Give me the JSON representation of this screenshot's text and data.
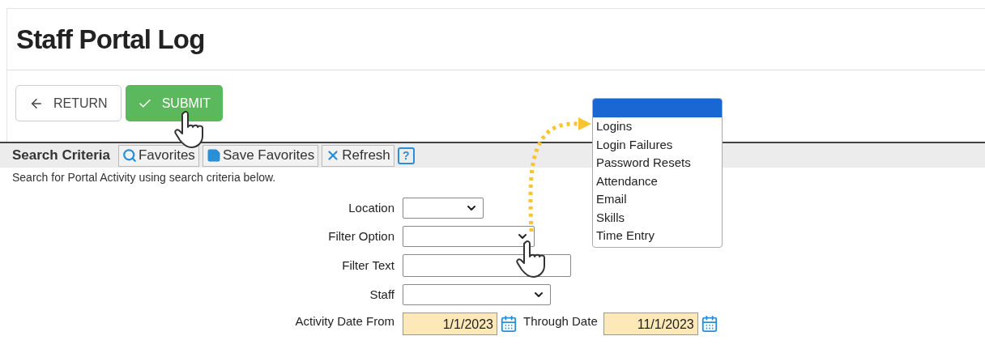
{
  "page": {
    "title": "Staff Portal Log"
  },
  "actions": [
    {
      "kind": "return",
      "label": "RETURN"
    },
    {
      "kind": "submit",
      "label": "SUBMIT"
    }
  ],
  "search_criteria": {
    "title": "Search Criteria",
    "tools": [
      {
        "kind": "search",
        "label": "Favorites"
      },
      {
        "kind": "save",
        "label": "Save Favorites"
      },
      {
        "kind": "refresh",
        "label": "Refresh"
      },
      {
        "kind": "help",
        "label": "?"
      }
    ],
    "description": "Search for Portal Activity using search criteria below."
  },
  "form": [
    {
      "kind": "select",
      "label": "Location"
    },
    {
      "kind": "select",
      "label": "Filter Option"
    },
    {
      "kind": "text",
      "label": "Filter Text"
    },
    {
      "kind": "select",
      "label": "Staff"
    }
  ],
  "dates": {
    "from_label": "Activity Date From",
    "from_value": "1/1/2023",
    "to_label": "Through Date",
    "to_value": "11/1/2023"
  },
  "filter_option_list": {
    "highlighted_blank": true,
    "options": [
      {
        "label": "Logins",
        "selected": false
      },
      {
        "label": "Login Failures",
        "selected": false
      },
      {
        "label": "Password Resets",
        "selected": false
      },
      {
        "label": "Attendance",
        "selected": false
      },
      {
        "label": "Email",
        "selected": false
      },
      {
        "label": "Skills",
        "selected": false
      },
      {
        "label": "Time Entry",
        "selected": false
      }
    ]
  }
}
